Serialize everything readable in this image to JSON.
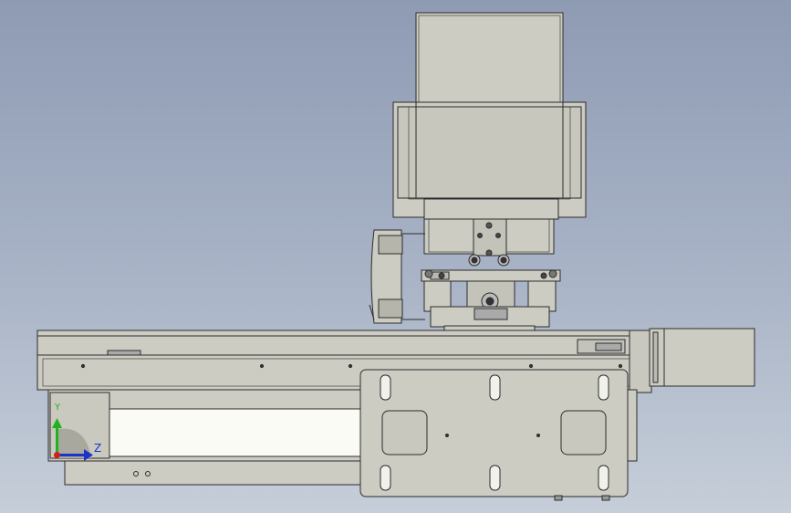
{
  "viewport": {
    "background_top": "#8e9bb3",
    "background_bottom": "#c6ced9"
  },
  "model": {
    "body_color": "#ccccc3",
    "edge_color": "#2c2c2c",
    "slot_color": "#fbfbf5"
  },
  "triad": {
    "y_label": "Y",
    "z_label": "Z",
    "y_axis_color": "#1db31d",
    "z_axis_color": "#1d33c8",
    "x_axis_color": "#d11d1d"
  }
}
